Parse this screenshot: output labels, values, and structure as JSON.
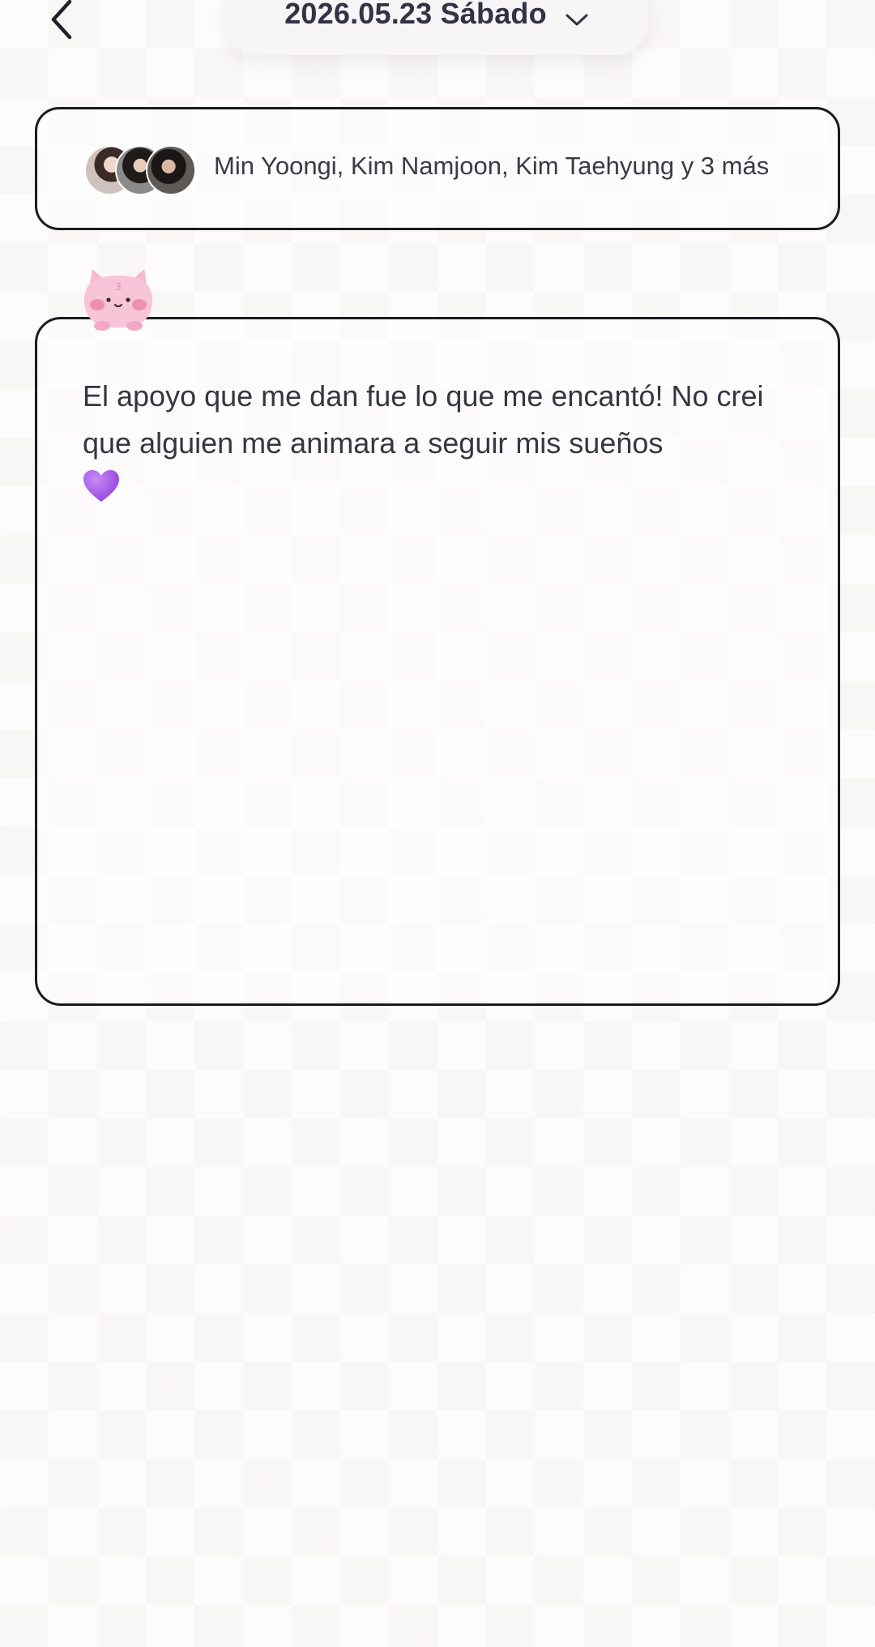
{
  "header": {
    "date_label": "2026.05.23 Sábado"
  },
  "participants": {
    "names_text": "Min Yoongi,  Kim Namjoon,  Kim Taehyung y 3 más",
    "avatars": [
      "avatar-1",
      "avatar-2",
      "avatar-3"
    ]
  },
  "note": {
    "text": "El apoyo que me dan fue lo que me encantó! No crei que alguien me animara a seguir mis sueños",
    "emoji_icon": "purple-heart-icon"
  },
  "mascot": {
    "icon": "pink-cat-mascot-icon",
    "badge_text": "3"
  },
  "colors": {
    "border": "#1b1b1f",
    "text": "#363642",
    "heart": "#a55ee8",
    "mascot_pink": "#f6b9cf"
  }
}
